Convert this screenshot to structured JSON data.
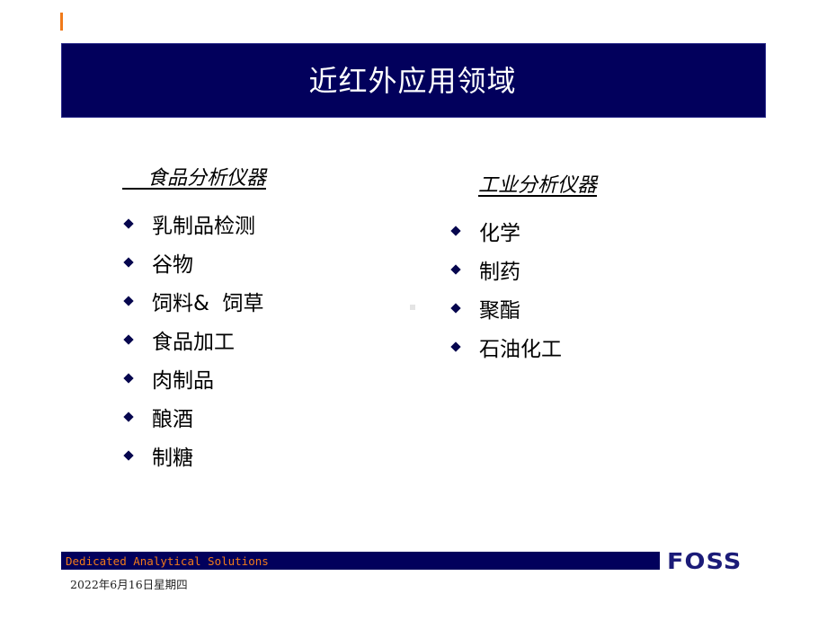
{
  "slide": {
    "title": "近红外应用领域",
    "left_column": {
      "heading": "    食品分析仪器",
      "items": [
        "乳制品检测",
        "谷物",
        "饲料&  饲草",
        "食品加工",
        "肉制品",
        "酿酒",
        "制糖"
      ]
    },
    "right_column": {
      "heading": "工业分析仪器",
      "items": [
        "化学",
        "制药",
        "聚酯",
        "石油化工"
      ]
    }
  },
  "footer": {
    "tagline": "Dedicated Analytical Solutions",
    "logo": "FOSS",
    "date": "2022年6月16日星期四"
  },
  "colors": {
    "banner": "#02005c",
    "accent_orange": "#f07a1a",
    "bullet": "#06064e",
    "logo": "#1b1b78"
  }
}
